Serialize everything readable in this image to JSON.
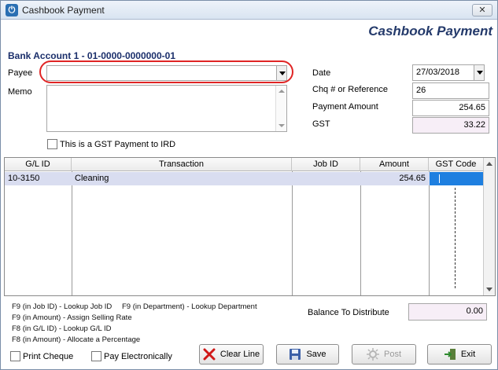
{
  "window": {
    "title": "Cashbook Payment",
    "header_title": "Cashbook Payment",
    "close_label": "✕"
  },
  "account": {
    "line": "Bank Account 1 - 01-0000-0000000-01"
  },
  "form": {
    "payee_label": "Payee",
    "payee_value": "",
    "memo_label": "Memo",
    "memo_value": "",
    "gst_payment_label": "This is a GST Payment to IRD",
    "date_label": "Date",
    "date_value": "27/03/2018",
    "chq_label": "Chq # or Reference",
    "chq_value": "26",
    "payment_amount_label": "Payment Amount",
    "payment_amount_value": "254.65",
    "gst_label": "GST",
    "gst_value": "33.22"
  },
  "grid": {
    "columns": [
      "G/L ID",
      "Transaction",
      "Job ID",
      "Amount",
      "GST Code"
    ],
    "rows": [
      {
        "gl_id": "10-3150",
        "transaction": "Cleaning",
        "job_id": "",
        "amount": "254.65",
        "gst_code": ""
      }
    ]
  },
  "hints": [
    "F9 (in Job ID) - Lookup Job ID",
    "F9 (in Department) - Lookup Department",
    "F9 (in Amount) - Assign Selling Rate",
    "F8 (in G/L ID) - Lookup G/L ID",
    "F8 (in Amount) - Allocate a Percentage"
  ],
  "balance": {
    "label": "Balance To Distribute",
    "value": "0.00"
  },
  "options": {
    "print_cheque": "Print Cheque",
    "pay_electronically": "Pay Electronically"
  },
  "buttons": {
    "clear_line": "Clear Line",
    "save": "Save",
    "post": "Post",
    "exit": "Exit"
  },
  "colors": {
    "header_title": "#243a6b",
    "highlight_oval": "#e02525",
    "selected_row": "#d9ddf0",
    "active_cell": "#1e7fe0"
  }
}
